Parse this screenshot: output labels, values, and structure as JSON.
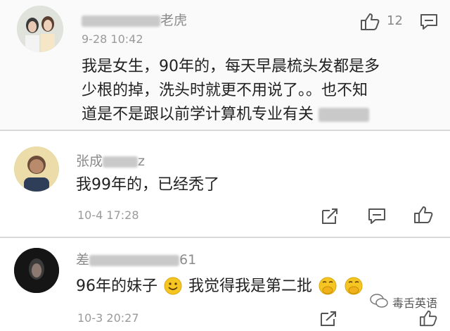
{
  "comments": [
    {
      "author_suffix": "老虎",
      "time": "9-28 10:42",
      "like_count": "12",
      "text_lines": [
        "我是女生，90年的，每天早晨梳头发都是多",
        "少根的掉，洗头时就更不用说了。。也不知",
        "道是不是跟以前学计算机专业有关"
      ]
    },
    {
      "author_visible": "张成",
      "author_suffix": "z",
      "time": "10-4 17:28",
      "text": "我99年的，已经秃了"
    },
    {
      "author_visible": "差",
      "author_suffix": "61",
      "time": "10-3 20:27",
      "text_part1": "96年的妹子",
      "text_part2": "我觉得我是第二批"
    }
  ],
  "watermark": "毒舌英语",
  "icons": {
    "like": "thumbs-up-icon",
    "comment": "comment-bubble-icon",
    "share": "share-icon"
  },
  "colors": {
    "text": "#222222",
    "meta": "#9a9a9a",
    "emoji": "#f5c623"
  }
}
